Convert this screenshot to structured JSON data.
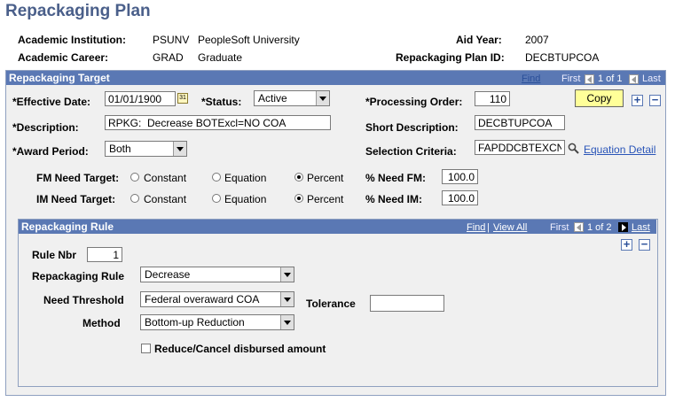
{
  "page_title": "Repackaging Plan",
  "header": {
    "institution_label": "Academic Institution:",
    "institution_code": "PSUNV",
    "institution_name": "PeopleSoft University",
    "aid_year_label": "Aid Year:",
    "aid_year": "2007",
    "career_label": "Academic Career:",
    "career_code": "GRAD",
    "career_name": "Graduate",
    "plan_id_label": "Repackaging Plan ID:",
    "plan_id": "DECBTUPCOA"
  },
  "target": {
    "title": "Repackaging Target",
    "find": "Find",
    "first": "First",
    "count": "1 of 1",
    "last": "Last",
    "effective_date_label": "*Effective Date:",
    "effective_date": "01/01/1900",
    "status_label": "*Status:",
    "status": "Active",
    "processing_order_label": "*Processing Order:",
    "processing_order": "110",
    "copy_label": "Copy",
    "description_label": "*Description:",
    "description": "RPKG:  Decrease BOTExcl=NO COA",
    "short_desc_label": "Short Description:",
    "short_desc": "DECBTUPCOA",
    "award_period_label": "*Award Period:",
    "award_period": "Both",
    "selection_criteria_label": "Selection Criteria:",
    "selection_criteria": "FAPDDCBTEXCN",
    "equation_detail": "Equation Detail",
    "fm_label": "FM Need Target:",
    "im_label": "IM Need Target:",
    "opt_constant": "Constant",
    "opt_equation": "Equation",
    "opt_percent": "Percent",
    "pct_fm_label": "% Need FM:",
    "pct_fm": "100.0",
    "pct_im_label": "% Need IM:",
    "pct_im": "100.0"
  },
  "rule": {
    "title": "Repackaging Rule",
    "find": "Find",
    "view_all": "View All",
    "first": "First",
    "count": "1 of 2",
    "last": "Last",
    "rule_nbr_label": "Rule Nbr",
    "rule_nbr": "1",
    "repackaging_rule_label": "Repackaging Rule",
    "repackaging_rule": "Decrease",
    "need_threshold_label": "Need Threshold",
    "need_threshold": "Federal overaward COA",
    "tolerance_label": "Tolerance",
    "tolerance": "",
    "method_label": "Method",
    "method": "Bottom-up Reduction",
    "reduce_label": "Reduce/Cancel disbursed amount"
  },
  "colors": {
    "header_bar": "#5a78b4",
    "title_text": "#4a5f8a",
    "link": "#2a55b8",
    "copy_button": "#ffff99",
    "panel_bg": "#f0f0f0"
  }
}
